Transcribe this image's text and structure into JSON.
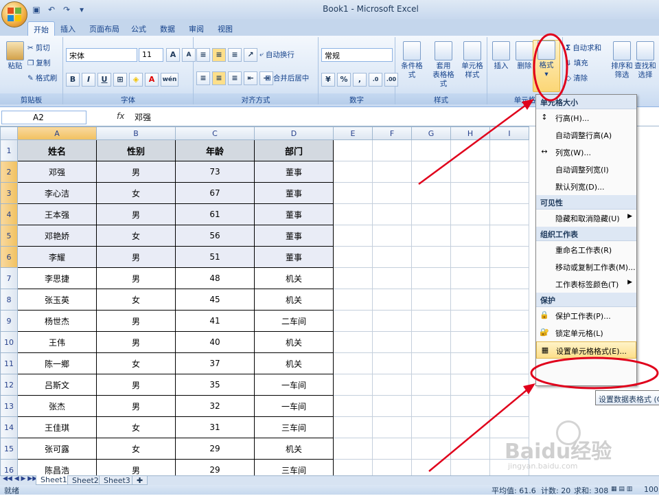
{
  "window": {
    "title": "Book1 - Microsoft Excel"
  },
  "tabs": [
    "开始",
    "插入",
    "页面布局",
    "公式",
    "数据",
    "审阅",
    "视图"
  ],
  "ribbon": {
    "clipboard": {
      "paste": "粘贴",
      "cut": "剪切",
      "copy": "复制",
      "format_painter": "格式刷",
      "label": "剪贴板"
    },
    "font": {
      "name": "宋体",
      "size": "11",
      "label": "字体",
      "bold": "B",
      "italic": "I",
      "underline": "U",
      "grow": "A",
      "shrink": "A",
      "wen": "wén"
    },
    "alignment": {
      "wrap": "自动换行",
      "merge": "合并后居中",
      "label": "对齐方式"
    },
    "number": {
      "format": "常规",
      "percent": "%",
      "comma": ",",
      "label": "数字"
    },
    "styles": {
      "conditional": "条件格式",
      "table_format": "套用",
      "table_format2": "表格格式",
      "cell_style": "单元格",
      "cell_style2": "样式",
      "label": "样式"
    },
    "cells": {
      "insert": "插入",
      "delete": "删除",
      "format": "格式",
      "label": "单元格"
    },
    "editing": {
      "autosum": "自动求和",
      "fill": "填充",
      "clear": "清除",
      "sort": "排序和",
      "sort2": "筛选",
      "find": "查找和",
      "find2": "选择",
      "sigma": "Σ"
    }
  },
  "formula_bar": {
    "name_box": "A2",
    "fx": "fx",
    "value": "邓强"
  },
  "columns": [
    "A",
    "B",
    "C",
    "D",
    "E",
    "F",
    "G",
    "H",
    "I"
  ],
  "headers": [
    "姓名",
    "性别",
    "年龄",
    "部门"
  ],
  "rows": [
    [
      "邓强",
      "男",
      "73",
      "董事"
    ],
    [
      "李心洁",
      "女",
      "67",
      "董事"
    ],
    [
      "王本强",
      "男",
      "61",
      "董事"
    ],
    [
      "邓艳娇",
      "女",
      "56",
      "董事"
    ],
    [
      "李耀",
      "男",
      "51",
      "董事"
    ],
    [
      "李思捷",
      "男",
      "48",
      "机关"
    ],
    [
      "张玉英",
      "女",
      "45",
      "机关"
    ],
    [
      "杨世杰",
      "男",
      "41",
      "二车间"
    ],
    [
      "王伟",
      "男",
      "40",
      "机关"
    ],
    [
      "陈一鄉",
      "女",
      "37",
      "机关"
    ],
    [
      "吕斯文",
      "男",
      "35",
      "一车间"
    ],
    [
      "张杰",
      "男",
      "32",
      "一车间"
    ],
    [
      "王佳琪",
      "女",
      "31",
      "三车间"
    ],
    [
      "张可露",
      "女",
      "29",
      "机关"
    ],
    [
      "陈昌浩",
      "男",
      "29",
      "三车间"
    ]
  ],
  "row_numbers": [
    "1",
    "2",
    "3",
    "4",
    "5",
    "6",
    "7",
    "8",
    "9",
    "10",
    "11",
    "12",
    "13",
    "14",
    "15",
    "16"
  ],
  "sheet_tabs": [
    "Sheet1",
    "Sheet2",
    "Sheet3"
  ],
  "status": {
    "ready": "就绪",
    "average": "平均值: 61.6",
    "count": "计数: 20",
    "sum": "求和: 308",
    "zoom": "100"
  },
  "menu": {
    "sections": {
      "cell_size": "单元格大小",
      "visibility": "可见性",
      "organize": "组织工作表",
      "protection": "保护"
    },
    "items": {
      "row_height": "行高(H)...",
      "autofit_row": "自动调整行高(A)",
      "col_width": "列宽(W)...",
      "autofit_col": "自动调整列宽(I)",
      "default_width": "默认列宽(D)...",
      "hide_unhide": "隐藏和取消隐藏(U)",
      "rename": "重命名工作表(R)",
      "move_copy": "移动或复制工作表(M)...",
      "tab_color": "工作表标签颜色(T)",
      "protect": "保护工作表(P)...",
      "lock": "锁定单元格(L)",
      "format_cells": "设置单元格格式(E)..."
    }
  },
  "tooltip": "设置数据表格式 (Ctrl",
  "watermark": {
    "brand": "Baidu经验",
    "url": "jingyan.baidu.com"
  },
  "colors": {
    "accent": "#e0001b",
    "highlight": "#fddf8a",
    "selection": "#e9ecf6",
    "header_fill": "#d3d9e0"
  }
}
